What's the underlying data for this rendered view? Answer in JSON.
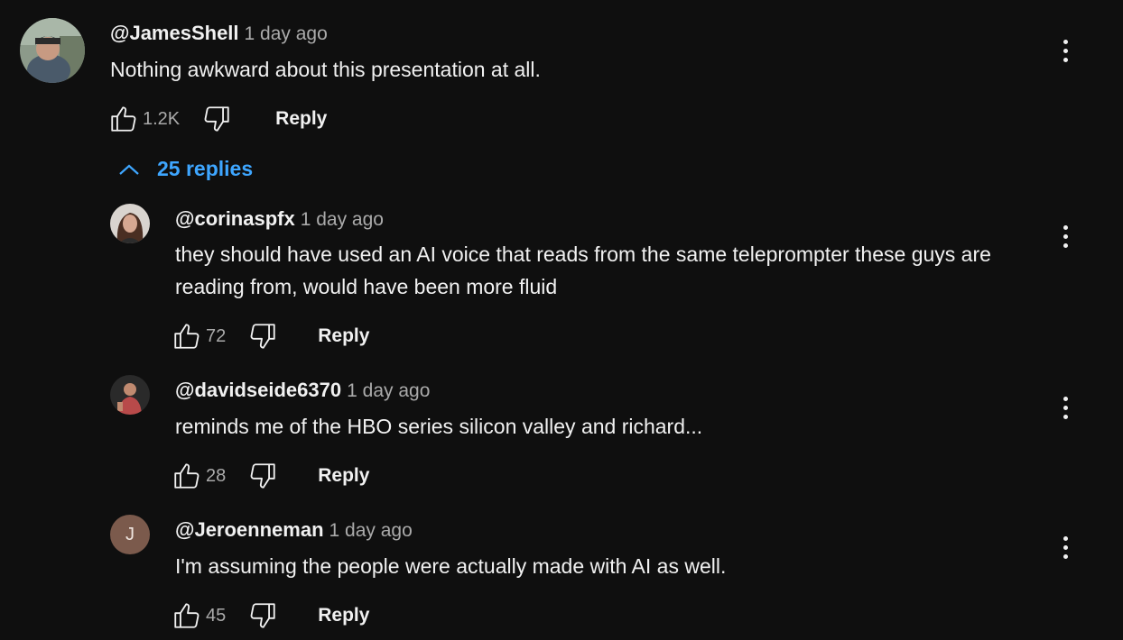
{
  "colors": {
    "background": "#0f0f0f",
    "text": "#f1f1f1",
    "muted": "#aaaaaa",
    "link": "#3ea6ff"
  },
  "top_comment": {
    "author": "@JamesShell",
    "time": "1 day ago",
    "text": "Nothing awkward about this presentation at all.",
    "likes": "1.2K",
    "reply_label": "Reply"
  },
  "replies_toggle": {
    "label": "25 replies",
    "icon": "chevron-up-icon"
  },
  "replies": [
    {
      "author": "@corinaspfx",
      "time": "1 day ago",
      "text": "they should have used an AI voice that reads from the same teleprompter these guys are reading from, would have been more fluid",
      "likes": "72",
      "reply_label": "Reply"
    },
    {
      "author": "@davidseide6370",
      "time": "1 day ago",
      "text": "reminds me of the HBO series silicon valley and richard...",
      "likes": "28",
      "reply_label": "Reply"
    },
    {
      "author": "@Jeroenneman",
      "time": "1 day ago",
      "text": "I'm assuming the people were actually made with AI as well.",
      "likes": "45",
      "reply_label": "Reply",
      "avatar_letter": "J"
    }
  ]
}
